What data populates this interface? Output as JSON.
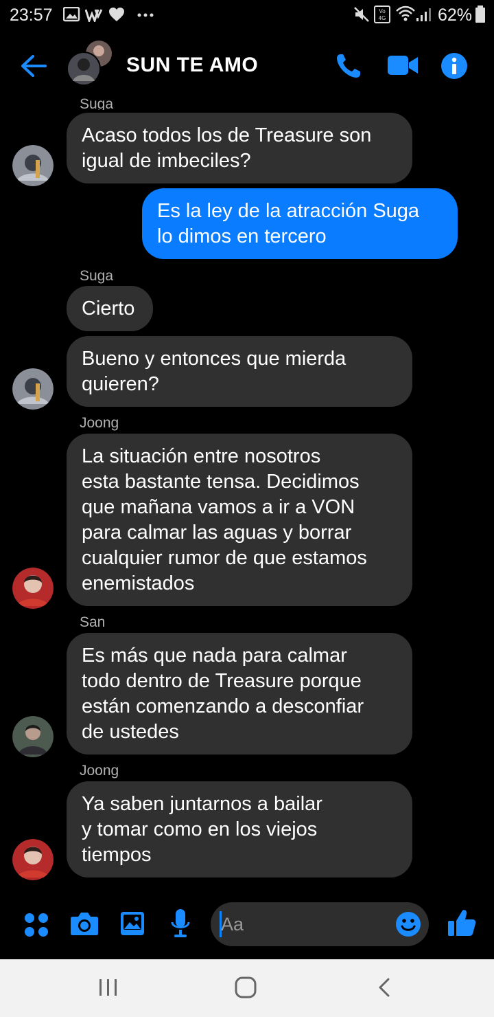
{
  "status_bar": {
    "time": "23:57",
    "battery_percent": "62%",
    "network": "VoLTE 4G"
  },
  "header": {
    "title": "SUN TE AMO"
  },
  "messages": [
    {
      "sender": "Suga",
      "text_lines": [
        "Acaso todos los de Treasure son",
        "igual de imbeciles?"
      ]
    },
    {
      "sender": "",
      "text_lines": [
        "Es la ley de la atracción Suga",
        "lo dimos en tercero"
      ],
      "outgoing": true
    },
    {
      "sender": "Suga",
      "text_lines": [
        "Cierto"
      ]
    },
    {
      "sender": "",
      "text_lines": [
        "Bueno y entonces que mierda",
        "quieren?"
      ]
    },
    {
      "sender": "Joong",
      "text_lines": [
        "La situación entre nosotros",
        "esta bastante tensa. Decidimos",
        "que mañana vamos a ir a VON",
        "para calmar las aguas y borrar",
        "cualquier rumor de que estamos",
        "enemistados"
      ]
    },
    {
      "sender": "San",
      "text_lines": [
        "Es más que nada para calmar",
        "todo dentro de Treasure porque",
        "están comenzando a desconfiar",
        "de ustedes"
      ]
    },
    {
      "sender": "Joong",
      "text_lines": [
        "Ya saben juntarnos a bailar",
        "y tomar como en los viejos",
        "tiempos"
      ]
    }
  ],
  "composer": {
    "placeholder": "Aa"
  },
  "colors": {
    "accent": "#0a7cff",
    "bubble_in": "#303030",
    "background": "#000000"
  }
}
